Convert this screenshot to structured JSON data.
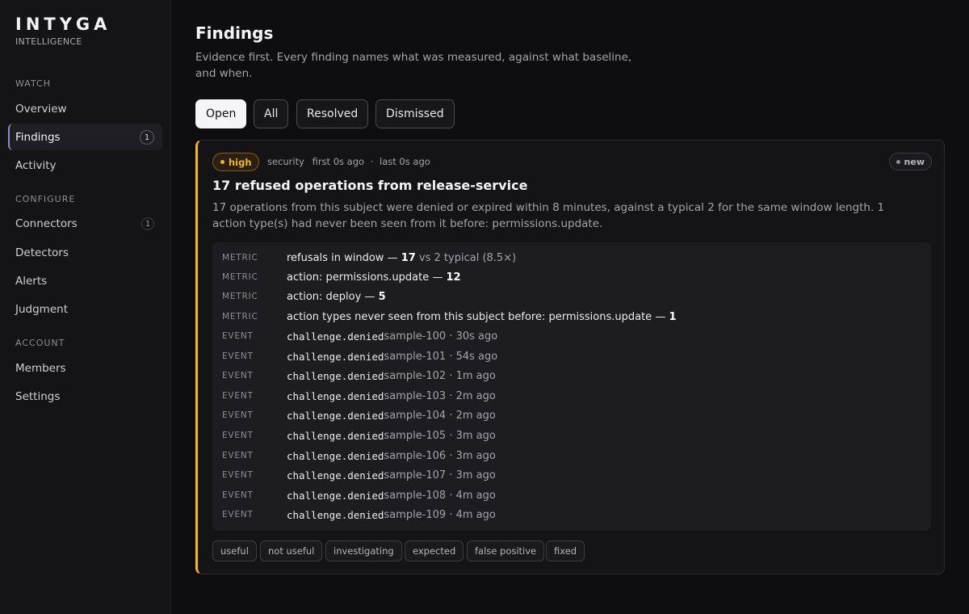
{
  "brand": {
    "name": "INTYGA",
    "subtitle": "INTELLIGENCE"
  },
  "sidebar": {
    "sections": [
      {
        "label": "WATCH"
      },
      {
        "label": "CONFIGURE"
      },
      {
        "label": "ACCOUNT"
      }
    ],
    "items": [
      {
        "label": "Overview"
      },
      {
        "label": "Findings",
        "badge": "1"
      },
      {
        "label": "Activity"
      },
      {
        "label": "Connectors",
        "badge": "1"
      },
      {
        "label": "Detectors"
      },
      {
        "label": "Alerts"
      },
      {
        "label": "Judgment"
      },
      {
        "label": "Members"
      },
      {
        "label": "Settings"
      }
    ]
  },
  "page": {
    "title": "Findings",
    "subtitle": "Evidence first. Every finding names what was measured, against what baseline, and when."
  },
  "filters": [
    "Open",
    "All",
    "Resolved",
    "Dismissed"
  ],
  "finding": {
    "severity": "high",
    "category": "security",
    "first_seen": "first 0s ago",
    "separator": "·",
    "last_seen": "last 0s ago",
    "status": "new",
    "title": "17 refused operations from release-service",
    "description": "17 operations from this subject were denied or expired within 8 minutes, against a typical 2 for the same window length. 1 action type(s) had never been seen from it before: permissions.update.",
    "metrics": [
      {
        "kind": "METRIC",
        "text": "refusals in window — ",
        "value": "17",
        "extra": " vs 2 typical (8.5×)"
      },
      {
        "kind": "METRIC",
        "text": "action: permissions.update — ",
        "value": "12",
        "extra": ""
      },
      {
        "kind": "METRIC",
        "text": "action: deploy — ",
        "value": "5",
        "extra": ""
      },
      {
        "kind": "METRIC",
        "text": "action types never seen from this subject before: permissions.update — ",
        "value": "1",
        "extra": ""
      }
    ],
    "events": [
      {
        "kind": "EVENT",
        "name": "challenge.denied",
        "detail": " sample-100 · 30s ago"
      },
      {
        "kind": "EVENT",
        "name": "challenge.denied",
        "detail": " sample-101 · 54s ago"
      },
      {
        "kind": "EVENT",
        "name": "challenge.denied",
        "detail": " sample-102 · 1m ago"
      },
      {
        "kind": "EVENT",
        "name": "challenge.denied",
        "detail": " sample-103 · 2m ago"
      },
      {
        "kind": "EVENT",
        "name": "challenge.denied",
        "detail": " sample-104 · 2m ago"
      },
      {
        "kind": "EVENT",
        "name": "challenge.denied",
        "detail": " sample-105 · 3m ago"
      },
      {
        "kind": "EVENT",
        "name": "challenge.denied",
        "detail": " sample-106 · 3m ago"
      },
      {
        "kind": "EVENT",
        "name": "challenge.denied",
        "detail": " sample-107 · 3m ago"
      },
      {
        "kind": "EVENT",
        "name": "challenge.denied",
        "detail": " sample-108 · 4m ago"
      },
      {
        "kind": "EVENT",
        "name": "challenge.denied",
        "detail": " sample-109 · 4m ago"
      }
    ],
    "judgments": [
      "useful",
      "not useful",
      "investigating",
      "expected",
      "false positive",
      "fixed"
    ]
  },
  "colors": {
    "accent_high": "#f2b62b",
    "background": "#0e0e10",
    "sidebar": "#141416"
  }
}
